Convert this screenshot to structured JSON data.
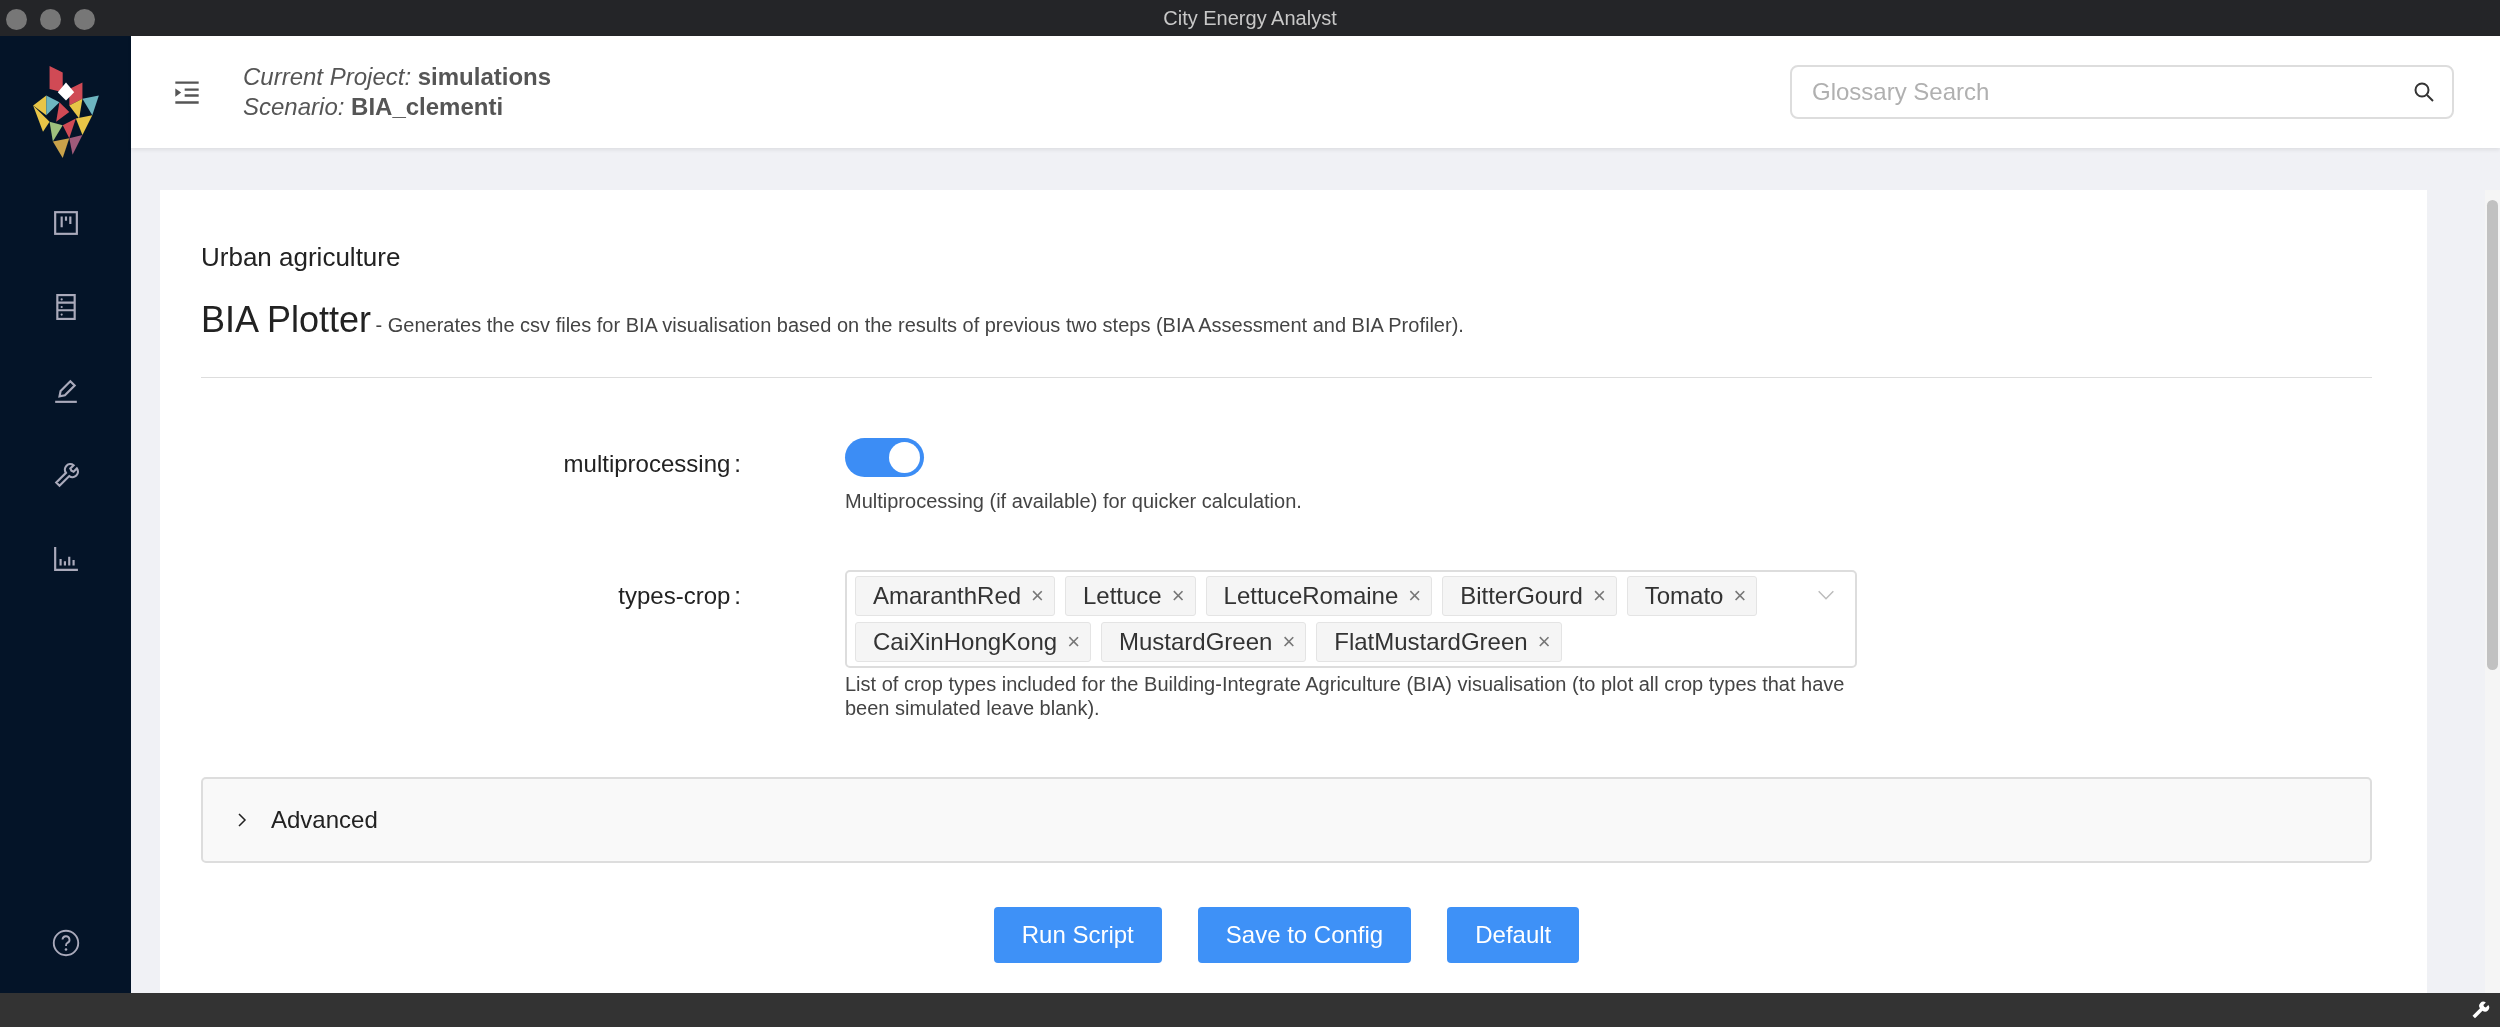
{
  "window": {
    "title": "City Energy Analyst"
  },
  "header": {
    "project_label": "Current Project:",
    "project": "simulations",
    "scenario_label": "Scenario:",
    "scenario": "BIA_clementi"
  },
  "search": {
    "placeholder": "Glossary Search"
  },
  "tool": {
    "category": "Urban agriculture",
    "name": "BIA Plotter",
    "description": "- Generates the csv files for BIA visualisation based on the results of previous two steps (BIA Assessment and BIA Profiler)."
  },
  "parameters": [
    {
      "kind": "toggle",
      "label": "multiprocessing",
      "separator": ":",
      "on": true,
      "help": "Multiprocessing (if available) for quicker calculation."
    },
    {
      "kind": "multiselect",
      "label": "types-crop",
      "separator": ":",
      "tags": [
        "AmaranthRed",
        "Lettuce",
        "LettuceRomaine",
        "BitterGourd",
        "Tomato",
        "CaiXinHongKong",
        "MustardGreen",
        "FlatMustardGreen"
      ],
      "remove_glyph": "×",
      "help": "List of crop types included for the Building-Integrate Agriculture (BIA) visualisation (to plot all crop types that have been simulated leave blank)."
    }
  ],
  "advanced": {
    "label": "Advanced",
    "expanded": false
  },
  "buttons": [
    "Run Script",
    "Save to Config",
    "Default"
  ]
}
